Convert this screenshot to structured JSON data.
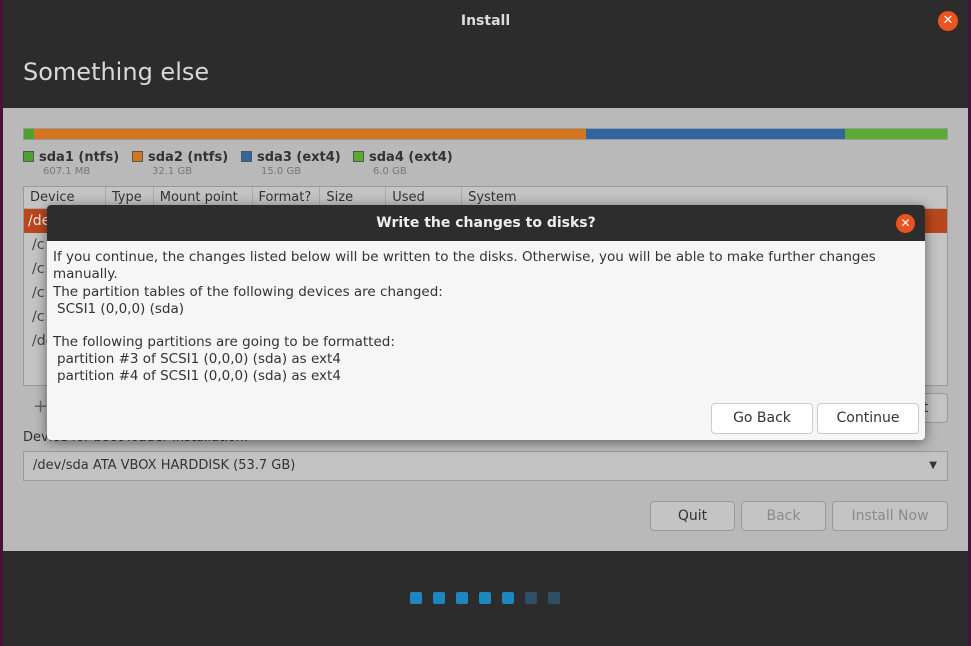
{
  "window": {
    "title": "Install",
    "heading": "Something else"
  },
  "partitions": [
    {
      "label": "sda1 (ntfs)",
      "size": "607.1 MB",
      "color": "#4ea12c",
      "share": 0.011
    },
    {
      "label": "sda2 (ntfs)",
      "size": "32.1 GB",
      "color": "#d3761f",
      "share": 0.598
    },
    {
      "label": "sda3 (ext4)",
      "size": "15.0 GB",
      "color": "#3264a0",
      "share": 0.28
    },
    {
      "label": "sda4 (ext4)",
      "size": "6.0 GB",
      "color": "#5aab2f",
      "share": 0.111
    }
  ],
  "table": {
    "columns": [
      "Device",
      "Type",
      "Mount point",
      "Format?",
      "Size",
      "Used",
      "System"
    ],
    "rows": [
      "/de",
      "/c",
      "/c",
      "/c",
      "/c",
      "/de"
    ]
  },
  "add_label": "+",
  "right_btn_fragment": "t",
  "boot": {
    "label": "Device for boot loader installation:",
    "value": "/dev/sda   ATA VBOX HARDDISK (53.7 GB)"
  },
  "buttons": {
    "quit": "Quit",
    "back": "Back",
    "install": "Install Now"
  },
  "progress": {
    "total": 7,
    "done": 5
  },
  "dialog": {
    "title": "Write the changes to disks?",
    "intro": "If you continue, the changes listed below will be written to the disks. Otherwise, you will be able to make further changes manually.",
    "tables_heading": "The partition tables of the following devices are changed:",
    "tables_items": [
      "SCSI1 (0,0,0) (sda)"
    ],
    "format_heading": "The following partitions are going to be formatted:",
    "format_items": [
      "partition #3 of SCSI1 (0,0,0) (sda) as ext4",
      "partition #4 of SCSI1 (0,0,0) (sda) as ext4"
    ],
    "go_back": "Go Back",
    "continue": "Continue"
  },
  "accent": "#e95420"
}
